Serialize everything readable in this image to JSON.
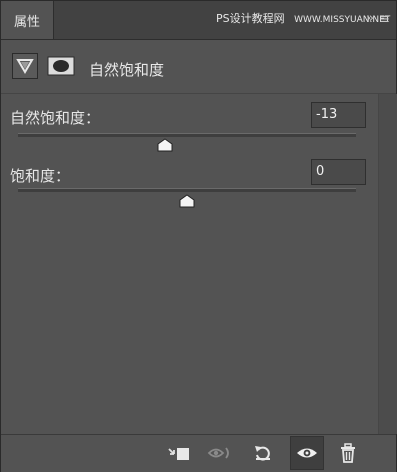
{
  "tab": {
    "title": "属性"
  },
  "watermark": {
    "left": "PS设计教程网",
    "right": "WWW.MISSYUAN.NET"
  },
  "panel_menu": {
    "collapse": "»",
    "menu": "≡"
  },
  "adjustment": {
    "title": "自然饱和度",
    "icon": "vibrance-icon",
    "mask_icon": "layer-mask-icon"
  },
  "controls": [
    {
      "label": "自然饱和度：",
      "value": "-13",
      "min": -100,
      "max": 100
    },
    {
      "label": "饱和度：",
      "value": "0",
      "min": -100,
      "max": 100
    }
  ],
  "bottom_bar": {
    "buttons": [
      {
        "name": "clip-to-layer-icon"
      },
      {
        "name": "view-previous-state-icon"
      },
      {
        "name": "reset-icon"
      },
      {
        "name": "visibility-eye-icon"
      },
      {
        "name": "trash-icon"
      }
    ]
  }
}
